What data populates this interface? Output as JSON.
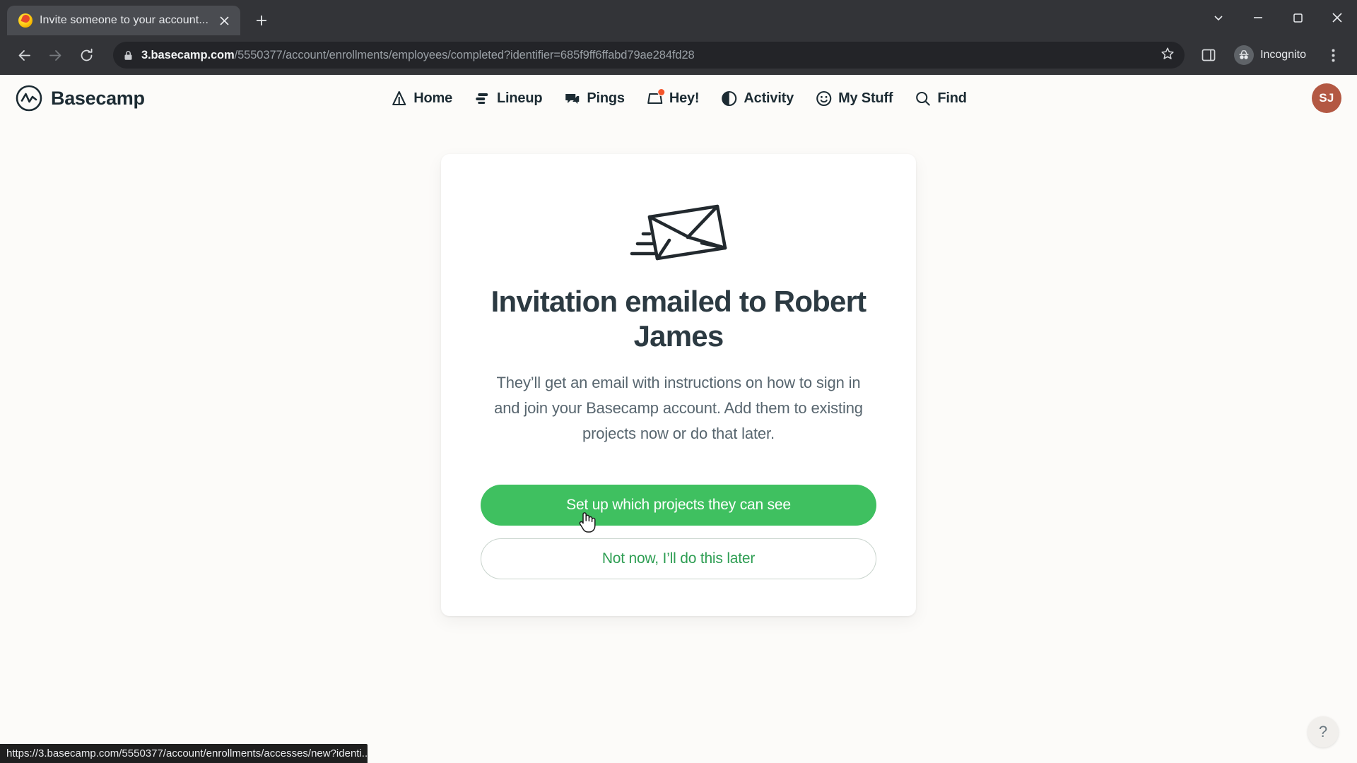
{
  "browser": {
    "tab": {
      "title": "Invite someone to your account...",
      "favicon": "basecamp-favicon",
      "close_icon": "close-icon"
    },
    "new_tab_label": "+",
    "window_controls": {
      "minimize_all": "chevron-down-icon",
      "minimize": "minimize-icon",
      "maximize": "maximize-icon",
      "close": "close-icon"
    },
    "nav_buttons": {
      "back": "back-arrow-icon",
      "forward": "forward-arrow-icon",
      "reload": "reload-icon"
    },
    "omnibox": {
      "lock_icon": "lock-icon",
      "url_domain": "3.basecamp.com",
      "url_path": "/5550377/account/enrollments/employees/completed?identifier=685f9ff6ffabd79ae284fd28",
      "bookmark_icon": "star-icon",
      "sidepanel_icon": "side-panel-icon"
    },
    "incognito": {
      "label": "Incognito",
      "icon": "incognito-icon"
    },
    "menu_icon": "kebab-menu-icon",
    "status_bar_url": "https://3.basecamp.com/5550377/account/enrollments/accesses/new?identi..."
  },
  "app": {
    "brand": {
      "name": "Basecamp",
      "logo": "basecamp-logo-icon"
    },
    "nav": [
      {
        "label": "Home",
        "icon": "home-tent-icon",
        "badge": false
      },
      {
        "label": "Lineup",
        "icon": "lineup-icon",
        "badge": false
      },
      {
        "label": "Pings",
        "icon": "pings-chat-icon",
        "badge": false
      },
      {
        "label": "Hey!",
        "icon": "hey-tray-icon",
        "badge": true
      },
      {
        "label": "Activity",
        "icon": "activity-pie-icon",
        "badge": false
      },
      {
        "label": "My Stuff",
        "icon": "my-stuff-smiley-icon",
        "badge": false
      },
      {
        "label": "Find",
        "icon": "search-icon",
        "badge": false
      }
    ],
    "avatar": {
      "initials": "SJ"
    },
    "help_label": "?"
  },
  "card": {
    "illustration": "envelope-icon",
    "title": "Invitation emailed to Robert James",
    "body": "They’ll get an email with instructions on how to sign in and join your Basecamp account. Add them to existing projects now or do that later.",
    "primary_button": "Set up which projects they can see",
    "secondary_button": "Not now, I’ll do this later"
  },
  "colors": {
    "accent_green": "#3fc060",
    "secondary_green": "#2e9e53",
    "badge_orange": "#f4552b",
    "page_bg": "#fcfbf9",
    "avatar_bg": "#b35843"
  }
}
